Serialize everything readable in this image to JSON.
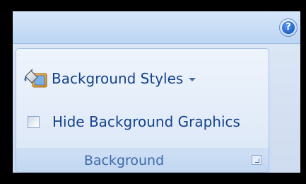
{
  "help": {
    "glyph": "?"
  },
  "group": {
    "title": "Background",
    "commands": {
      "background_styles": {
        "label": "Background Styles",
        "icon": "paint-bucket-icon",
        "has_dropdown": true
      },
      "hide_background_graphics": {
        "label": "Hide Background Graphics",
        "checked": false
      }
    },
    "launcher_icon": "dialog-launcher-icon"
  },
  "colors": {
    "text": "#15428b",
    "group_label": "#3e6aa8",
    "border": "#a8c1e3"
  }
}
